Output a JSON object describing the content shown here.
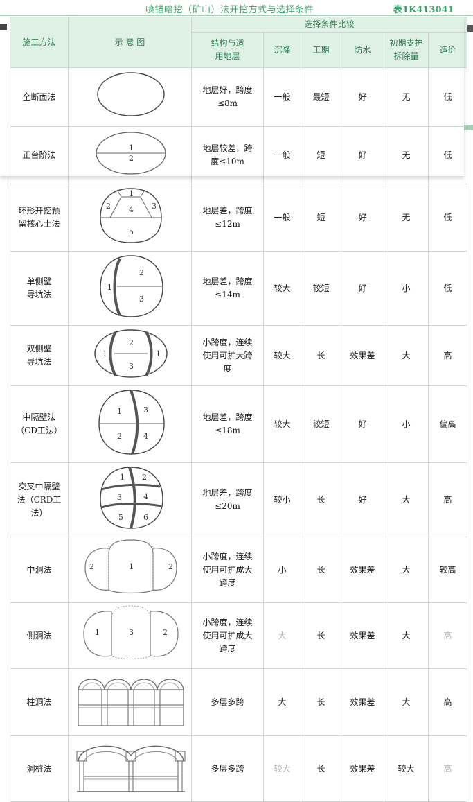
{
  "caption": {
    "title": "喷锚暗挖（矿山）法开挖方式与选择条件",
    "number": "表1K413041"
  },
  "headers": {
    "method": "施工方法",
    "diagram": "示 意 图",
    "group": "选择条件比较",
    "structure": [
      "结构与适",
      "用地层"
    ],
    "settlement": "沉降",
    "period": "工期",
    "waterproof": "防水",
    "support": [
      "初期支护",
      "拆除量"
    ],
    "cost": "造价"
  },
  "rows": [
    {
      "method": [
        "全断面法"
      ],
      "structure": [
        "地层好，跨度",
        "≤8m"
      ],
      "settlement": "一般",
      "period": "最短",
      "waterproof": "好",
      "support": "无",
      "cost": "低"
    },
    {
      "method": [
        "正台阶法"
      ],
      "structure": [
        "地层较差，跨",
        "度≤10m"
      ],
      "settlement": "一般",
      "period": "短",
      "waterproof": "好",
      "support": "无",
      "cost": "低"
    },
    {
      "method": [
        "环形开挖预",
        "留核心土法"
      ],
      "structure": [
        "地层差，跨度",
        "≤12m"
      ],
      "settlement": "一般",
      "period": "短",
      "waterproof": "好",
      "support": "无",
      "cost": "低"
    },
    {
      "method": [
        "单侧壁",
        "导坑法"
      ],
      "structure": [
        "地层差，跨度",
        "≤14m"
      ],
      "settlement": "较大",
      "period": "较短",
      "waterproof": "好",
      "support": "小",
      "cost": "低"
    },
    {
      "method": [
        "双侧壁",
        "导坑法"
      ],
      "structure": [
        "小跨度，连续",
        "使用可扩大跨",
        "度"
      ],
      "settlement": "较大",
      "period": "长",
      "waterproof": "效果差",
      "support": "大",
      "cost": "高"
    },
    {
      "method": [
        "中隔壁法",
        "（CD工法）"
      ],
      "structure": [
        "地层差，跨度",
        "≤18m"
      ],
      "settlement": "较大",
      "period": "较短",
      "waterproof": "好",
      "support": "小",
      "cost": "偏高"
    },
    {
      "method": [
        "交叉中隔壁",
        "法（CRD工",
        "法）"
      ],
      "structure": [
        "地层差，跨度",
        "≤20m"
      ],
      "settlement": "较小",
      "period": "长",
      "waterproof": "好",
      "support": "大",
      "cost": "高"
    },
    {
      "method": [
        "中洞法"
      ],
      "structure": [
        "小跨度，连续",
        "使用可扩成大",
        "跨度"
      ],
      "settlement": "小",
      "period": "长",
      "waterproof": "效果差",
      "support": "大",
      "cost": "较高"
    },
    {
      "method": [
        "侧洞法"
      ],
      "structure": [
        "小跨度，连续",
        "使用可扩成大",
        "跨度"
      ],
      "settlement": "大",
      "period": "长",
      "waterproof": "效果差",
      "support": "大",
      "cost": "高"
    },
    {
      "method": [
        "柱洞法"
      ],
      "structure": [
        "多层多跨"
      ],
      "settlement": "大",
      "period": "长",
      "waterproof": "效果差",
      "support": "大",
      "cost": "高"
    },
    {
      "method": [
        "洞桩法"
      ],
      "structure": [
        "多层多跨"
      ],
      "settlement": "较大",
      "period": "长",
      "waterproof": "效果差",
      "support": "较大",
      "cost": "高"
    }
  ],
  "diagram_labels": {
    "bench": [
      "1",
      "2"
    ],
    "ring": [
      "1",
      "2",
      "3",
      "4",
      "5"
    ],
    "single_side": [
      "1",
      "2",
      "3"
    ],
    "double_side": [
      "1",
      "1",
      "2",
      "3"
    ],
    "cd": [
      "1",
      "3",
      "2",
      "4"
    ],
    "crd": [
      "1",
      "2",
      "3",
      "4",
      "5",
      "6"
    ],
    "center_drift": [
      "2",
      "1",
      "2"
    ],
    "side_drift": [
      "1",
      "3",
      "2"
    ]
  }
}
